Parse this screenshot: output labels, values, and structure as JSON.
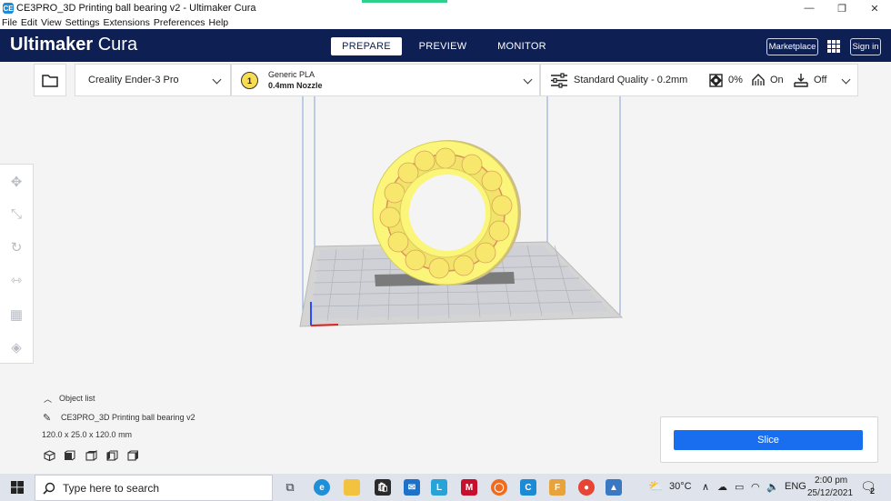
{
  "window": {
    "title": "CE3PRO_3D Printing ball bearing v2 - Ultimaker Cura",
    "app_icon": "CE",
    "controls": [
      "—",
      "❐",
      "✕"
    ]
  },
  "menu": [
    "File",
    "Edit",
    "View",
    "Settings",
    "Extensions",
    "Preferences",
    "Help"
  ],
  "header": {
    "brand_bold": "Ultimaker",
    "brand_light": "Cura",
    "tabs": [
      {
        "label": "PREPARE",
        "active": true
      },
      {
        "label": "PREVIEW",
        "active": false
      },
      {
        "label": "MONITOR",
        "active": false
      }
    ],
    "marketplace": "Marketplace",
    "sign_in": "Sign in"
  },
  "stage": {
    "printer": "Creality Ender-3 Pro",
    "material_badge": "1",
    "material_name": "Generic PLA",
    "nozzle": "0.4mm Nozzle",
    "quality": "Standard Quality - 0.2mm",
    "infill": "0%",
    "support": "On",
    "adhesion": "Off"
  },
  "object_list": {
    "header": "Object list",
    "item": "CE3PRO_3D Printing ball bearing v2",
    "dimensions": "120.0 x 25.0 x 120.0 mm"
  },
  "slice": {
    "label": "Slice"
  },
  "taskbar": {
    "search_placeholder": "Type here to search",
    "weather": "30°C",
    "language": "ENG",
    "time": "2:00 pm",
    "date": "25/12/2021",
    "notifications": "2"
  },
  "colors": {
    "header_bg": "#0d1f53",
    "slice_btn": "#196ef0",
    "model_fill": "#fbf57a",
    "model_ball": "#f8e86a",
    "build_plate": "#c8c8c8"
  }
}
